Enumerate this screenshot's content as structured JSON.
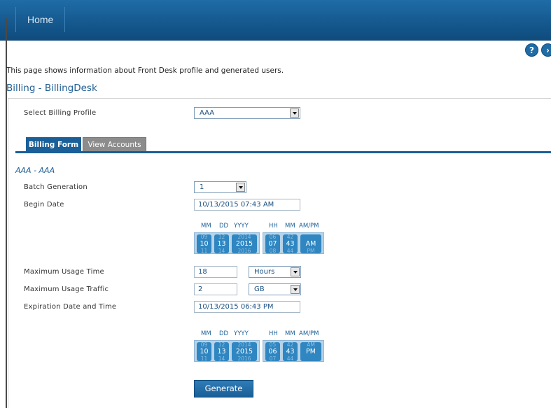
{
  "nav": {
    "home_label": "Home"
  },
  "icons": {
    "help": "?",
    "next": "›"
  },
  "page": {
    "description": "This page shows information about Front Desk profile and generated users.",
    "title": "Billing - BillingDesk"
  },
  "profile": {
    "label": "Select Billing Profile",
    "value": "AAA"
  },
  "tabs": [
    {
      "label": "Billing Form",
      "active": true
    },
    {
      "label": "View Accounts",
      "active": false
    }
  ],
  "form": {
    "section_title": "AAA - AAA",
    "batch": {
      "label": "Batch Generation",
      "value": "1"
    },
    "begin": {
      "label": "Begin Date",
      "value": "10/13/2015 07:43 AM"
    },
    "begin_picker": {
      "headers": {
        "mm": "MM",
        "dd": "DD",
        "yyyy": "YYYY",
        "hh": "HH",
        "min": "MM",
        "ampm": "AM/PM"
      },
      "mm": {
        "prev": "09",
        "cur": "10",
        "next": "11"
      },
      "dd": {
        "prev": "12",
        "cur": "13",
        "next": "14"
      },
      "yyyy": {
        "prev": "2014",
        "cur": "2015",
        "next": "2016"
      },
      "hh": {
        "prev": "06",
        "cur": "07",
        "next": "08"
      },
      "min": {
        "prev": "42",
        "cur": "43",
        "next": "44"
      },
      "ampm": {
        "prev": "",
        "cur": "AM",
        "next": "PM"
      }
    },
    "max_time": {
      "label": "Maximum Usage Time",
      "value": "18",
      "unit": "Hours"
    },
    "max_traffic": {
      "label": "Maximum Usage Traffic",
      "value": "2",
      "unit": "GB"
    },
    "expiration": {
      "label": "Expiration Date and Time",
      "value": "10/13/2015 06:43 PM"
    },
    "exp_picker": {
      "headers": {
        "mm": "MM",
        "dd": "DD",
        "yyyy": "YYYY",
        "hh": "HH",
        "min": "MM",
        "ampm": "AM/PM"
      },
      "mm": {
        "prev": "09",
        "cur": "10",
        "next": "11"
      },
      "dd": {
        "prev": "12",
        "cur": "13",
        "next": "14"
      },
      "yyyy": {
        "prev": "2014",
        "cur": "2015",
        "next": "2016"
      },
      "hh": {
        "prev": "05",
        "cur": "06",
        "next": "07"
      },
      "min": {
        "prev": "42",
        "cur": "43",
        "next": "44"
      },
      "ampm": {
        "prev": "AM",
        "cur": "PM",
        "next": ""
      }
    },
    "generate_label": "Generate"
  }
}
